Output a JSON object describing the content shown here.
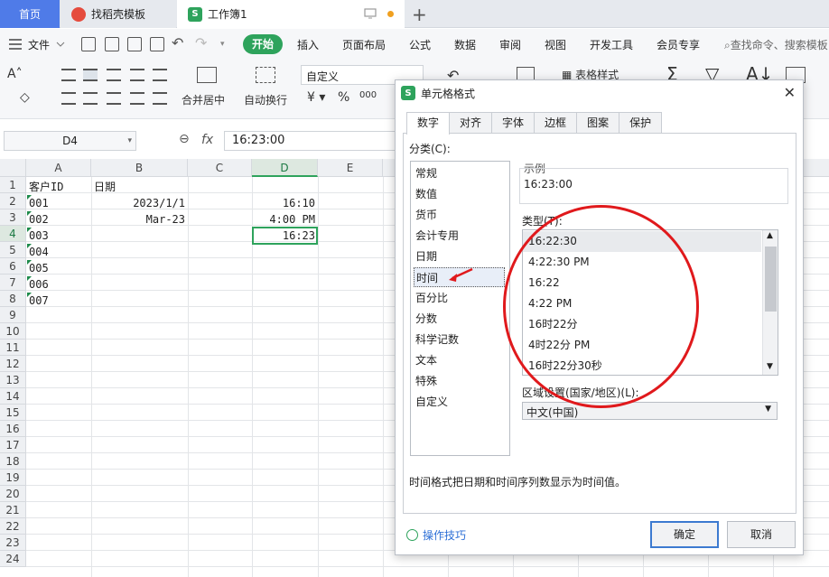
{
  "tabs": {
    "home": "首页",
    "daoke": "找稻壳模板",
    "workbook": "工作簿1"
  },
  "menu": {
    "file": "文件",
    "start": "开始",
    "items": [
      "插入",
      "页面布局",
      "公式",
      "数据",
      "审阅",
      "视图",
      "开发工具",
      "会员专享"
    ],
    "search": "查找命令、搜索模板"
  },
  "ribbon": {
    "merge": "合并居中",
    "wrap": "自动换行",
    "format": "自定义",
    "table_style": "表格样式"
  },
  "formula_bar": {
    "name_box": "D4",
    "fx": "fx",
    "formula": "16:23:00"
  },
  "grid": {
    "columns": [
      "A",
      "B",
      "C",
      "D",
      "E"
    ],
    "rows": [
      "1",
      "2",
      "3",
      "4",
      "5",
      "6",
      "7",
      "8",
      "9",
      "10",
      "11",
      "12",
      "13",
      "14",
      "15",
      "16",
      "17",
      "18",
      "19",
      "20",
      "21",
      "22",
      "23",
      "24"
    ],
    "A": [
      "客户ID",
      "001",
      "002",
      "003",
      "004",
      "005",
      "006",
      "007"
    ],
    "B": [
      "日期",
      "2023/1/1",
      "Mar-23"
    ],
    "D": [
      "",
      "16:10",
      "4:00 PM",
      "16:23"
    ]
  },
  "dialog": {
    "title": "单元格格式",
    "tabs": [
      "数字",
      "对齐",
      "字体",
      "边框",
      "图案",
      "保护"
    ],
    "category_label": "分类(C):",
    "categories": [
      "常规",
      "数值",
      "货币",
      "会计专用",
      "日期",
      "时间",
      "百分比",
      "分数",
      "科学记数",
      "文本",
      "特殊",
      "自定义"
    ],
    "sample_label": "示例",
    "sample_value": "16:23:00",
    "type_label": "类型(T):",
    "types": [
      "16:22:30",
      "4:22:30 PM",
      "16:22",
      "4:22 PM",
      "16时22分",
      "4时22分 PM",
      "16时22分30秒"
    ],
    "locale_label": "区域设置(国家/地区)(L):",
    "locale_value": "中文(中国)",
    "description": "时间格式把日期和时间序列数显示为时间值。",
    "tips": "操作技巧",
    "ok": "确定",
    "cancel": "取消"
  },
  "colors": {
    "accent_green": "#2ea35c",
    "annotation_red": "#e0191c"
  }
}
